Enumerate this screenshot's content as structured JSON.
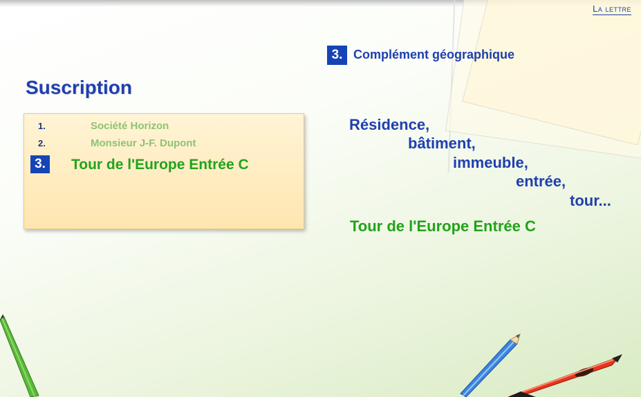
{
  "header": {
    "link_label": "La lettre"
  },
  "title": "Suscription",
  "address_box": {
    "lines": [
      {
        "num": "1.",
        "text": "Société Horizon"
      },
      {
        "num": "2.",
        "text": "Monsieur J-F. Dupont"
      },
      {
        "num": "3.",
        "text": "Tour de l'Europe Entrée C"
      }
    ]
  },
  "section": {
    "number": "3.",
    "heading": "Complément géographique"
  },
  "terms": [
    "Résidence,",
    "bâtiment,",
    "immeuble,",
    "entrée,",
    "tour..."
  ],
  "example": "Tour de l'Europe Entrée C",
  "colors": {
    "title_blue": "#1e3fae",
    "active_green": "#21a31a",
    "faded_green": "#8cc473",
    "badge_blue": "#1544b6",
    "box_fill": "#ffe6b0"
  },
  "icons": [
    "green-pencil-icon",
    "blue-pencil-icon",
    "red-pencil-icon"
  ]
}
